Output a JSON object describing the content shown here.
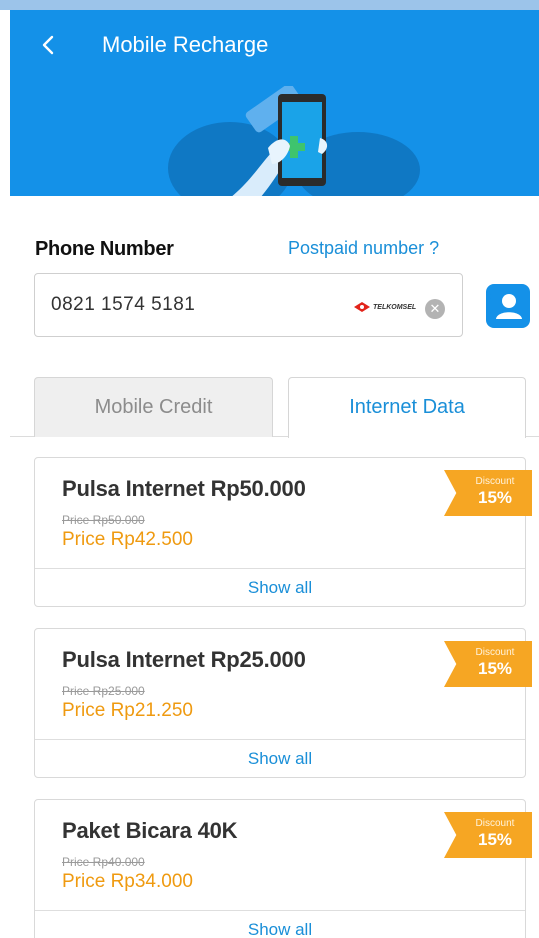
{
  "header": {
    "title": "Mobile Recharge",
    "back_icon": "chevron-left-icon",
    "background_color": "#1491e8"
  },
  "phone": {
    "label": "Phone Number",
    "postpaid_link": "Postpaid number ?",
    "value": "0821 1574 5181",
    "operator": "TELKOMSEL",
    "clear_icon": "clear-icon",
    "contact_icon": "contact-book-icon"
  },
  "tabs": [
    {
      "label": "Mobile Credit",
      "active": false
    },
    {
      "label": "Internet Data",
      "active": true
    }
  ],
  "products": [
    {
      "name": "Pulsa Internet Rp50.000",
      "old_price": "Price Rp50.000",
      "price": "Price Rp42.500",
      "badge_label": "Discount",
      "badge_value": "15%",
      "show_all": "Show all"
    },
    {
      "name": "Pulsa Internet Rp25.000",
      "old_price": "Price Rp25.000",
      "price": "Price Rp21.250",
      "badge_label": "Discount",
      "badge_value": "15%",
      "show_all": "Show all"
    },
    {
      "name": "Paket Bicara 40K",
      "old_price": "Price Rp40.000",
      "price": "Price Rp34.000",
      "badge_label": "Discount",
      "badge_value": "15%",
      "show_all": "Show all"
    }
  ],
  "colors": {
    "accent": "#1491e8",
    "price": "#ef9a10",
    "badge": "#f6a623"
  }
}
